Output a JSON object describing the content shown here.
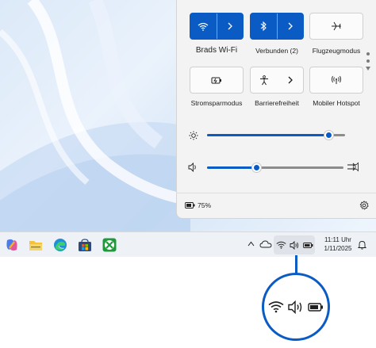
{
  "quick_settings": {
    "tiles": [
      {
        "id": "wifi",
        "label": "Brads Wi-Fi",
        "active": true,
        "icon": "wifi-icon",
        "has_arrow": true
      },
      {
        "id": "bluetooth",
        "label": "Verbunden (2)",
        "active": true,
        "icon": "bluetooth-icon",
        "has_arrow": true
      },
      {
        "id": "airplane",
        "label": "Flugzeugmodus",
        "active": false,
        "icon": "airplane-icon",
        "has_arrow": false
      },
      {
        "id": "battery-saver",
        "label": "Stromsparmodus",
        "active": false,
        "icon": "battery-saver-icon",
        "has_arrow": false
      },
      {
        "id": "accessibility",
        "label": "Barrierefreiheit",
        "active": false,
        "icon": "accessibility-icon",
        "has_arrow": true
      },
      {
        "id": "hotspot",
        "label": "Mobiler Hotspot",
        "active": false,
        "icon": "hotspot-icon",
        "has_arrow": false
      }
    ],
    "brightness_level": 0.88,
    "volume_level": 0.36,
    "battery_percent": "75%"
  },
  "taskbar": {
    "apps": [
      "copilot-icon",
      "file-explorer-icon",
      "edge-icon",
      "store-icon",
      "xbox-icon"
    ],
    "time": "11:11 Uhr",
    "date": "1/11/2025"
  },
  "colors": {
    "accent": "#0a5cc4",
    "panel_bg": "#f3f3f3",
    "taskbar_bg": "#eef1f5"
  }
}
